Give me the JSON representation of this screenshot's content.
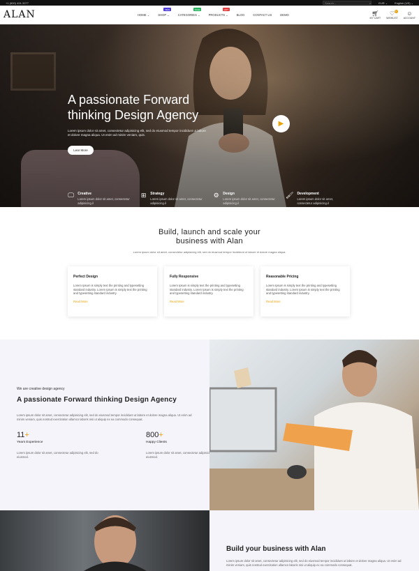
{
  "topbar": {
    "phone": "+1 (600) 491-3277",
    "search_placeholder": "Search...",
    "currency": "EUR",
    "language": "English (US)"
  },
  "nav": {
    "logo": "ALAN",
    "menu": [
      {
        "label": "HOME",
        "caret": "⌄",
        "badge": "",
        "badge_color": ""
      },
      {
        "label": "SHOP",
        "caret": "⌄",
        "badge": "NEW",
        "badge_color": "#4c3bd6"
      },
      {
        "label": "CATEGORIES",
        "caret": "⌄",
        "badge": "SALE",
        "badge_color": "#27b25e"
      },
      {
        "label": "PRODUCTS",
        "caret": "⌄",
        "badge": "HOT",
        "badge_color": "#e33b3b"
      },
      {
        "label": "BLOG",
        "caret": "",
        "badge": "",
        "badge_color": ""
      },
      {
        "label": "CONTACT US",
        "caret": "",
        "badge": "",
        "badge_color": ""
      },
      {
        "label": "DEMO",
        "caret": "",
        "badge": "",
        "badge_color": ""
      }
    ],
    "icons": [
      {
        "label": "MY CART",
        "icon": "cart-icon"
      },
      {
        "label": "WISHLIST",
        "icon": "heart-icon",
        "count": "0"
      },
      {
        "label": "ACCOUNT",
        "icon": "user-icon"
      }
    ]
  },
  "hero": {
    "title": "A passionate Forward thinking Design Agency",
    "subtitle": "Lorem ipsum dolor sit amet, consectetur adipisicing elit, sed do eiusmod tempor incididunt ut labore et dolore magna aliqua. Ut enim ad minim veniam, quis.",
    "button": "Lear More",
    "features": [
      {
        "title": "Creative",
        "icon": "monitor-icon",
        "text": "Lorem ipsum dolor sit amet, consectetur adipisicing.il"
      },
      {
        "title": "Strategy",
        "icon": "strategy-icon",
        "text": "Lorem ipsum dolor sit amet, consectetur adipisicing.il"
      },
      {
        "title": "Design",
        "icon": "gears-icon",
        "text": "Lorem ipsum dolor sit amet, consectetur adipisicing.il"
      },
      {
        "title": "Development",
        "icon": "brush-icon",
        "text": "Lorem ipsum dolor sit amet, consectetur adipisicing.il"
      }
    ]
  },
  "build": {
    "title_line1": "Build, launch and scale your",
    "title_line2": "business with Alan",
    "subtitle": "Lorem ipsum dolor sit amet, consectetur adipisicing elit, sed do eiusmod tempor incididunt ut labore et dolore magna aliqua.",
    "cards": [
      {
        "title": "Perfect Design",
        "text": "Lorem Ipsum is simply text the printing and typesetting standard industry. Lorem Ipsum is simply text the printing and typesetting standard industry.",
        "link": "Read More"
      },
      {
        "title": "Fully Responsive",
        "text": "Lorem Ipsum is simply text the printing and typesetting standard industry. Lorem Ipsum is simply text the printing and typesetting standard industry.",
        "link": "Read More"
      },
      {
        "title": "Reasonable Pricing",
        "text": "Lorem Ipsum is simply text the printing and typesetting standard industry. Lorem Ipsum is simply text the printing and typesetting standard industry.",
        "link": "Read More"
      }
    ]
  },
  "about": {
    "kicker": "We are creative design agency",
    "title": "A passionate Forward thinking Design Agency",
    "text": "Lorem ipsum dolor sit amet, consectetur adipisicing elit, sed do eiusmod tempor incididunt ut labore et dolore magna aliqua. Ut enim ad minim veniam, quis nostrud exercitation ullamco laboris nisi ut aliquip ex ea commodo consequat.",
    "stats": [
      {
        "number": "11",
        "plus": "+",
        "label": "Years Experience",
        "text": "Lorem ipsum dolor sit amet, consectetur adipisicing elit, sed do eiusmod."
      },
      {
        "number": "800",
        "plus": "+",
        "label": "Happy Clients",
        "text": "Lorem ipsum dolor sit amet, consectetur adipisicing elit, sed do eiusmod."
      }
    ]
  },
  "build2": {
    "title": "Build your business with Alan",
    "text": "Lorem ipsum dolor sit amet, consectetur adipisicing elit, sed do eiusmod tempor incididunt ut labore et dolore magna aliqua. Ut enim ad minim veniam, quis nostrud exercitation ullamco laboris nisi ut aliquip ex ea commodo consequat."
  }
}
